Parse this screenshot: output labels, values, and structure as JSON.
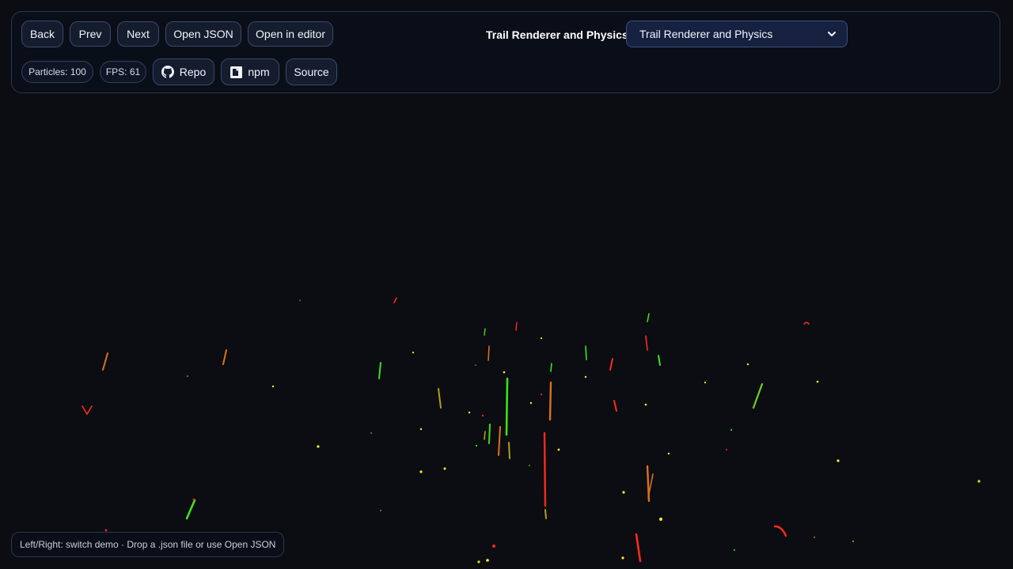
{
  "toolbar": {
    "back_label": "Back",
    "prev_label": "Prev",
    "next_label": "Next",
    "open_json_label": "Open JSON",
    "open_editor_label": "Open in editor",
    "demo_title": "Trail Renderer and Physics",
    "demo_select_value": "Trail Renderer and Physics"
  },
  "stats": {
    "particles_label": "Particles: 100",
    "fps_label": "FPS: 61"
  },
  "links": {
    "repo_label": "Repo",
    "npm_label": "npm",
    "source_label": "Source",
    "repo_icon": "github-icon",
    "npm_icon": "npm-icon"
  },
  "footer": {
    "hint_text": "Left/Right: switch demo · Drop a .json file or use Open JSON"
  },
  "colors": {
    "background": "#0b0d12",
    "panel_border": "#2a3650",
    "button_bg": "#141c2e",
    "select_bg": "#162140",
    "particle_red": "#ff2a1a",
    "particle_orange": "#e0701a",
    "particle_green": "#3ee01a",
    "particle_yellow": "#ffee22"
  }
}
